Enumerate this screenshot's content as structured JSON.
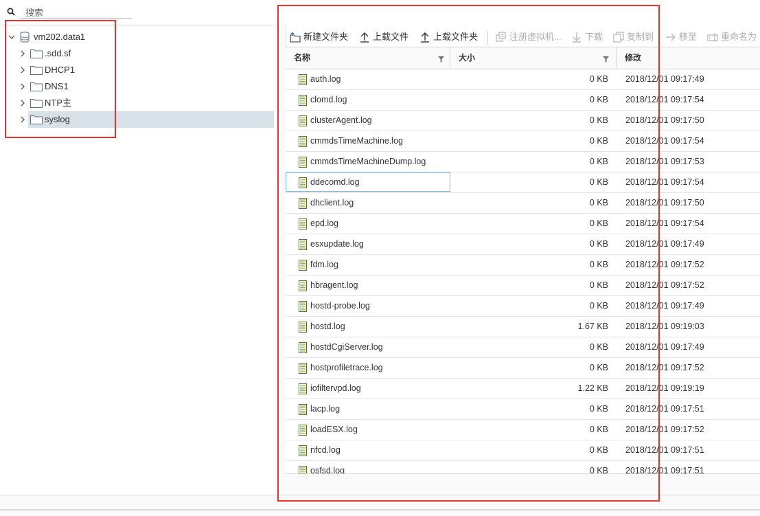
{
  "search": {
    "placeholder": "搜索"
  },
  "tree": {
    "root": {
      "label": "vm202.data1"
    },
    "children": [
      {
        "label": ".sdd.sf"
      },
      {
        "label": "DHCP1"
      },
      {
        "label": "DNS1"
      },
      {
        "label": "NTP主"
      },
      {
        "label": "syslog",
        "selected": true
      }
    ]
  },
  "toolbar": {
    "new_folder": "新建文件夹",
    "upload_file": "上载文件",
    "upload_folder": "上载文件夹",
    "register_vm": "注册虚拟机...",
    "download": "下载",
    "copy_to": "复制到",
    "move_to": "移至",
    "rename": "重命名为"
  },
  "grid": {
    "columns": {
      "name": "名称",
      "size": "大小",
      "modified": "修改"
    },
    "rows": [
      {
        "name": "auth.log",
        "size": "0 KB",
        "modified": "2018/12/01 09:17:49"
      },
      {
        "name": "clomd.log",
        "size": "0 KB",
        "modified": "2018/12/01 09:17:54"
      },
      {
        "name": "clusterAgent.log",
        "size": "0 KB",
        "modified": "2018/12/01 09:17:50"
      },
      {
        "name": "cmmdsTimeMachine.log",
        "size": "0 KB",
        "modified": "2018/12/01 09:17:54"
      },
      {
        "name": "cmmdsTimeMachineDump.log",
        "size": "0 KB",
        "modified": "2018/12/01 09:17:53"
      },
      {
        "name": "ddecomd.log",
        "size": "0 KB",
        "modified": "2018/12/01 09:17:54"
      },
      {
        "name": "dhclient.log",
        "size": "0 KB",
        "modified": "2018/12/01 09:17:50"
      },
      {
        "name": "epd.log",
        "size": "0 KB",
        "modified": "2018/12/01 09:17:54"
      },
      {
        "name": "esxupdate.log",
        "size": "0 KB",
        "modified": "2018/12/01 09:17:49"
      },
      {
        "name": "fdm.log",
        "size": "0 KB",
        "modified": "2018/12/01 09:17:52"
      },
      {
        "name": "hbragent.log",
        "size": "0 KB",
        "modified": "2018/12/01 09:17:52"
      },
      {
        "name": "hostd-probe.log",
        "size": "0 KB",
        "modified": "2018/12/01 09:17:49"
      },
      {
        "name": "hostd.log",
        "size": "1.67 KB",
        "modified": "2018/12/01 09:19:03"
      },
      {
        "name": "hostdCgiServer.log",
        "size": "0 KB",
        "modified": "2018/12/01 09:17:49"
      },
      {
        "name": "hostprofiletrace.log",
        "size": "0 KB",
        "modified": "2018/12/01 09:17:52"
      },
      {
        "name": "iofiltervpd.log",
        "size": "1.22 KB",
        "modified": "2018/12/01 09:19:19"
      },
      {
        "name": "lacp.log",
        "size": "0 KB",
        "modified": "2018/12/01 09:17:51"
      },
      {
        "name": "loadESX.log",
        "size": "0 KB",
        "modified": "2018/12/01 09:17:52"
      },
      {
        "name": "nfcd.log",
        "size": "0 KB",
        "modified": "2018/12/01 09:17:51"
      },
      {
        "name": "osfsd.log",
        "size": "0 KB",
        "modified": "2018/12/01 09:17:51"
      }
    ]
  },
  "colors": {
    "highlight": "#e3342f",
    "selected": "#d7e1e8",
    "focus": "#6fb7e6"
  }
}
